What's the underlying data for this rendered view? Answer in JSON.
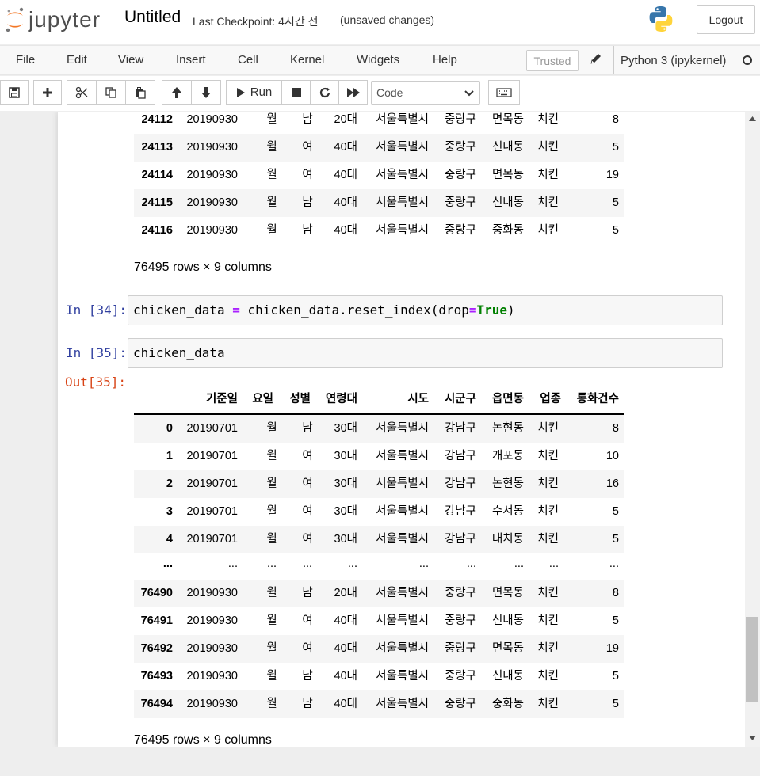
{
  "header": {
    "logo_text": "jupyter",
    "notebook_title": "Untitled",
    "checkpoint": "Last Checkpoint: 4시간 전",
    "autosave_status": "(unsaved changes)",
    "logout_label": "Logout"
  },
  "menubar": {
    "items": [
      "File",
      "Edit",
      "View",
      "Insert",
      "Cell",
      "Kernel",
      "Widgets",
      "Help"
    ],
    "trusted_label": "Trusted",
    "kernel_name": "Python 3 (ipykernel)"
  },
  "toolbar": {
    "run_label": "Run",
    "cell_type": "Code"
  },
  "cells": {
    "top_output": {
      "rows": [
        {
          "idx": "24112",
          "date": "20190930",
          "day": "월",
          "sex": "남",
          "age": "20대",
          "city": "서울특별시",
          "gu": "중랑구",
          "dong": "면목동",
          "biz": "치킨",
          "cnt": "8"
        },
        {
          "idx": "24113",
          "date": "20190930",
          "day": "월",
          "sex": "여",
          "age": "40대",
          "city": "서울특별시",
          "gu": "중랑구",
          "dong": "신내동",
          "biz": "치킨",
          "cnt": "5"
        },
        {
          "idx": "24114",
          "date": "20190930",
          "day": "월",
          "sex": "여",
          "age": "40대",
          "city": "서울특별시",
          "gu": "중랑구",
          "dong": "면목동",
          "biz": "치킨",
          "cnt": "19"
        },
        {
          "idx": "24115",
          "date": "20190930",
          "day": "월",
          "sex": "남",
          "age": "40대",
          "city": "서울특별시",
          "gu": "중랑구",
          "dong": "신내동",
          "biz": "치킨",
          "cnt": "5"
        },
        {
          "idx": "24116",
          "date": "20190930",
          "day": "월",
          "sex": "남",
          "age": "40대",
          "city": "서울특별시",
          "gu": "중랑구",
          "dong": "중화동",
          "biz": "치킨",
          "cnt": "5"
        }
      ],
      "shape": "76495 rows × 9 columns"
    },
    "cell34": {
      "prompt": "In [34]:",
      "code_lhs": "chicken_data ",
      "code_op": "=",
      "code_mid": " chicken_data.reset_index(drop",
      "code_eq": "=",
      "code_true": "True",
      "code_end": ")"
    },
    "cell35": {
      "prompt": "In [35]:",
      "code": "chicken_data",
      "out_prompt": "Out[35]:",
      "columns": [
        "기준일",
        "요일",
        "성별",
        "연령대",
        "시도",
        "시군구",
        "읍면동",
        "업종",
        "통화건수"
      ],
      "rows": [
        {
          "idx": "0",
          "date": "20190701",
          "day": "월",
          "sex": "남",
          "age": "30대",
          "city": "서울특별시",
          "gu": "강남구",
          "dong": "논현동",
          "biz": "치킨",
          "cnt": "8"
        },
        {
          "idx": "1",
          "date": "20190701",
          "day": "월",
          "sex": "여",
          "age": "30대",
          "city": "서울특별시",
          "gu": "강남구",
          "dong": "개포동",
          "biz": "치킨",
          "cnt": "10"
        },
        {
          "idx": "2",
          "date": "20190701",
          "day": "월",
          "sex": "여",
          "age": "30대",
          "city": "서울특별시",
          "gu": "강남구",
          "dong": "논현동",
          "biz": "치킨",
          "cnt": "16"
        },
        {
          "idx": "3",
          "date": "20190701",
          "day": "월",
          "sex": "여",
          "age": "30대",
          "city": "서울특별시",
          "gu": "강남구",
          "dong": "수서동",
          "biz": "치킨",
          "cnt": "5"
        },
        {
          "idx": "4",
          "date": "20190701",
          "day": "월",
          "sex": "여",
          "age": "30대",
          "city": "서울특별시",
          "gu": "강남구",
          "dong": "대치동",
          "biz": "치킨",
          "cnt": "5"
        },
        {
          "idx": "...",
          "date": "...",
          "day": "...",
          "sex": "...",
          "age": "...",
          "city": "...",
          "gu": "...",
          "dong": "...",
          "biz": "...",
          "cnt": "..."
        },
        {
          "idx": "76490",
          "date": "20190930",
          "day": "월",
          "sex": "남",
          "age": "20대",
          "city": "서울특별시",
          "gu": "중랑구",
          "dong": "면목동",
          "biz": "치킨",
          "cnt": "8"
        },
        {
          "idx": "76491",
          "date": "20190930",
          "day": "월",
          "sex": "여",
          "age": "40대",
          "city": "서울특별시",
          "gu": "중랑구",
          "dong": "신내동",
          "biz": "치킨",
          "cnt": "5"
        },
        {
          "idx": "76492",
          "date": "20190930",
          "day": "월",
          "sex": "여",
          "age": "40대",
          "city": "서울특별시",
          "gu": "중랑구",
          "dong": "면목동",
          "biz": "치킨",
          "cnt": "19"
        },
        {
          "idx": "76493",
          "date": "20190930",
          "day": "월",
          "sex": "남",
          "age": "40대",
          "city": "서울특별시",
          "gu": "중랑구",
          "dong": "신내동",
          "biz": "치킨",
          "cnt": "5"
        },
        {
          "idx": "76494",
          "date": "20190930",
          "day": "월",
          "sex": "남",
          "age": "40대",
          "city": "서울특별시",
          "gu": "중랑구",
          "dong": "중화동",
          "biz": "치킨",
          "cnt": "5"
        }
      ],
      "shape": "76495 rows × 9 columns"
    }
  },
  "colors": {
    "in_prompt": "#303F9F",
    "out_prompt": "#D84315",
    "logo_orange": "#F37726"
  }
}
